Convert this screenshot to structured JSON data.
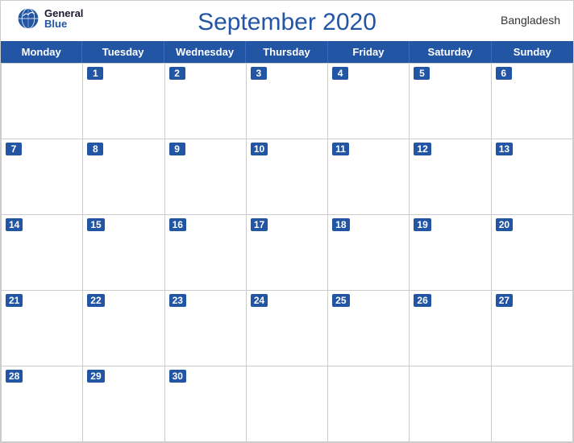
{
  "header": {
    "title": "September 2020",
    "country": "Bangladesh"
  },
  "logo": {
    "line1": "General",
    "line2": "Blue"
  },
  "days": {
    "headers": [
      "Monday",
      "Tuesday",
      "Wednesday",
      "Thursday",
      "Friday",
      "Saturday",
      "Sunday"
    ]
  },
  "weeks": [
    [
      {
        "num": "",
        "empty": true
      },
      {
        "num": "1"
      },
      {
        "num": "2"
      },
      {
        "num": "3"
      },
      {
        "num": "4"
      },
      {
        "num": "5"
      },
      {
        "num": "6"
      }
    ],
    [
      {
        "num": "7"
      },
      {
        "num": "8"
      },
      {
        "num": "9"
      },
      {
        "num": "10"
      },
      {
        "num": "11"
      },
      {
        "num": "12"
      },
      {
        "num": "13"
      }
    ],
    [
      {
        "num": "14"
      },
      {
        "num": "15"
      },
      {
        "num": "16"
      },
      {
        "num": "17"
      },
      {
        "num": "18"
      },
      {
        "num": "19"
      },
      {
        "num": "20"
      }
    ],
    [
      {
        "num": "21"
      },
      {
        "num": "22"
      },
      {
        "num": "23"
      },
      {
        "num": "24"
      },
      {
        "num": "25"
      },
      {
        "num": "26"
      },
      {
        "num": "27"
      }
    ],
    [
      {
        "num": "28"
      },
      {
        "num": "29"
      },
      {
        "num": "30"
      },
      {
        "num": "",
        "empty": true
      },
      {
        "num": "",
        "empty": true
      },
      {
        "num": "",
        "empty": true
      },
      {
        "num": "",
        "empty": true
      }
    ]
  ]
}
